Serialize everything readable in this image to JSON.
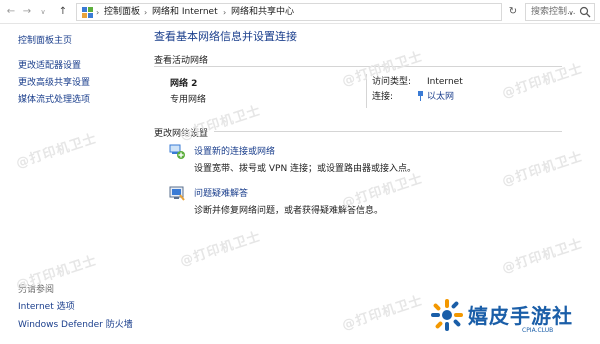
{
  "address_bar": {
    "back": "←",
    "forward": "→",
    "recent": "∨",
    "up": "↑",
    "breadcrumbs": [
      "控制面板",
      "网络和 Internet",
      "网络和共享中心"
    ],
    "separator": "›",
    "dropdown": "∨",
    "refresh": "↻",
    "search_placeholder": "搜索控制..."
  },
  "sidebar": {
    "home": "控制面板主页",
    "items": [
      "更改适配器设置",
      "更改高级共享设置",
      "媒体流式处理选项"
    ],
    "see_also_title": "另请参阅",
    "see_also": [
      "Internet 选项",
      "Windows Defender 防火墙"
    ]
  },
  "main": {
    "title": "查看基本网络信息并设置连接",
    "active_networks_header": "查看活动网络",
    "network": {
      "name": "网络 2",
      "type": "专用网络",
      "access_type_label": "访问类型:",
      "access_type_value": "Internet",
      "connections_label": "连接:",
      "connections_value": "以太网"
    },
    "change_settings_header": "更改网络设置",
    "tasks": [
      {
        "link": "设置新的连接或网络",
        "desc": "设置宽带、拨号或 VPN 连接；或设置路由器或接入点。",
        "icon": "network-setup-icon"
      },
      {
        "link": "问题疑难解答",
        "desc": "诊断并修复网络问题，或者获得疑难解答信息。",
        "icon": "troubleshoot-icon"
      }
    ]
  },
  "watermark": {
    "text": "@打印机卫士"
  },
  "logo": {
    "name": "嬉皮手游社",
    "sub": "CPIA.CLUB"
  },
  "colors": {
    "link": "#1a3e8c",
    "logo_blue": "#1a5ea8",
    "logo_orange": "#f39800"
  }
}
